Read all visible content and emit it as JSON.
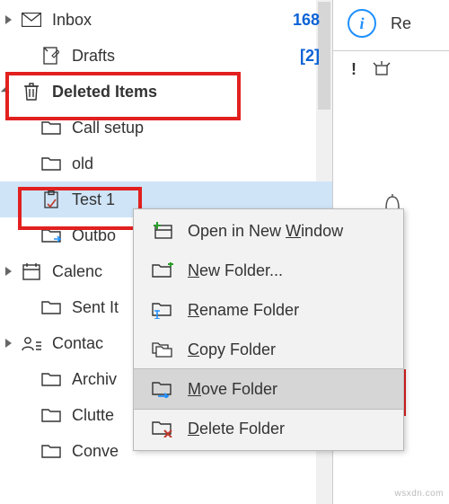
{
  "preview": {
    "re_label": "Re",
    "flag": "!"
  },
  "sidebar": {
    "items": [
      {
        "label": "Inbox",
        "count": "168",
        "bold": false
      },
      {
        "label": "Drafts",
        "count": "[2]",
        "bold": false
      },
      {
        "label": "Deleted Items",
        "count": "",
        "bold": true
      },
      {
        "label": "Call setup",
        "count": "",
        "bold": false
      },
      {
        "label": "old",
        "count": "",
        "bold": false
      },
      {
        "label": "Test 1",
        "count": "",
        "bold": false
      },
      {
        "label": "Outbo",
        "count": "",
        "bold": false
      },
      {
        "label": "Calenc",
        "count": "",
        "bold": false
      },
      {
        "label": "Sent It",
        "count": "",
        "bold": false
      },
      {
        "label": "Contac",
        "count": "",
        "bold": false
      },
      {
        "label": "Archiv",
        "count": "",
        "bold": false
      },
      {
        "label": "Clutte",
        "count": "",
        "bold": false
      },
      {
        "label": "Conve",
        "count": "",
        "bold": false
      }
    ]
  },
  "context_menu": {
    "items": [
      {
        "label_html": "Open in New <span class='mn'>W</span>indow"
      },
      {
        "label_html": "<span class='mn'>N</span>ew Folder..."
      },
      {
        "label_html": "<span class='mn'>R</span>ename Folder"
      },
      {
        "label_html": "<span class='mn'>C</span>opy Folder"
      },
      {
        "label_html": "<span class='mn'>M</span>ove Folder"
      },
      {
        "label_html": "<span class='mn'>D</span>elete Folder"
      }
    ]
  },
  "watermark": "wsxdn.com"
}
